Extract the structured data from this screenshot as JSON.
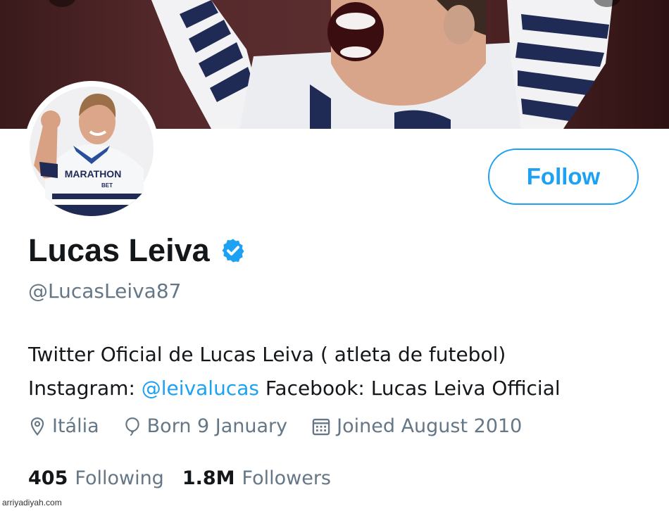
{
  "profile": {
    "display_name": "Lucas Leiva",
    "handle": "@LucasLeiva87",
    "verified": true,
    "bio": {
      "line1": "Twitter Oficial de Lucas Leiva ( atleta de futebol)",
      "line2_prefix": "Instagram: ",
      "line2_mention": "@leivalucas",
      "line2_suffix": " Facebook: Lucas Leiva Official"
    },
    "meta": {
      "location": "Itália",
      "birthday": "Born 9 January",
      "joined": "Joined August 2010"
    },
    "stats": {
      "following_count": "405",
      "following_label": "Following",
      "followers_count": "1.8M",
      "followers_label": "Followers"
    },
    "avatar_jersey_text": "MARATHON",
    "avatar_jersey_subtext": "BET"
  },
  "actions": {
    "follow_label": "Follow"
  },
  "icons": {
    "verified": "verified-badge-icon",
    "location": "location-pin-icon",
    "birthday": "balloon-icon",
    "joined": "calendar-icon"
  },
  "colors": {
    "accent": "#1da1f2",
    "text_primary": "#14171a",
    "text_secondary": "#657786"
  },
  "watermark": "arriyadiyah.com"
}
